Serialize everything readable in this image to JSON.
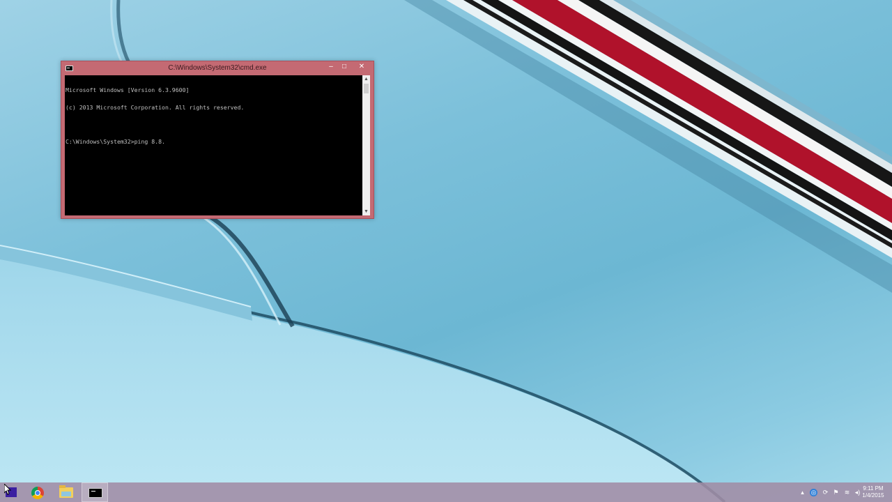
{
  "window": {
    "title": "C:\\Windows\\System32\\cmd.exe",
    "controls": {
      "minimize": "–",
      "maximize": "□",
      "close": "✕"
    },
    "console_lines": [
      "Microsoft Windows [Version 6.3.9600]",
      "(c) 2013 Microsoft Corporation. All rights reserved.",
      "",
      "C:\\Windows\\System32>ping 8.8."
    ]
  },
  "taskbar": {
    "start_icon": "windows-start-icon",
    "pinned": [
      {
        "name": "Google Chrome",
        "icon": "chrome-icon"
      },
      {
        "name": "File Explorer",
        "icon": "folder-icon"
      },
      {
        "name": "Command Prompt",
        "icon": "console-icon",
        "active": true
      }
    ],
    "tray_icons": [
      "chevron-up-icon",
      "globe-icon",
      "sync-icon",
      "flag-icon",
      "wifi-icon",
      "volume-icon"
    ],
    "clock": {
      "time": "9:11 PM",
      "date": "1/4/2015"
    }
  },
  "colors": {
    "window_frame": "#c46a73",
    "console_background": "#000000",
    "console_text": "#c0c0c0",
    "taskbar": "#a08ca5",
    "wallpaper": "#7cc0da"
  }
}
